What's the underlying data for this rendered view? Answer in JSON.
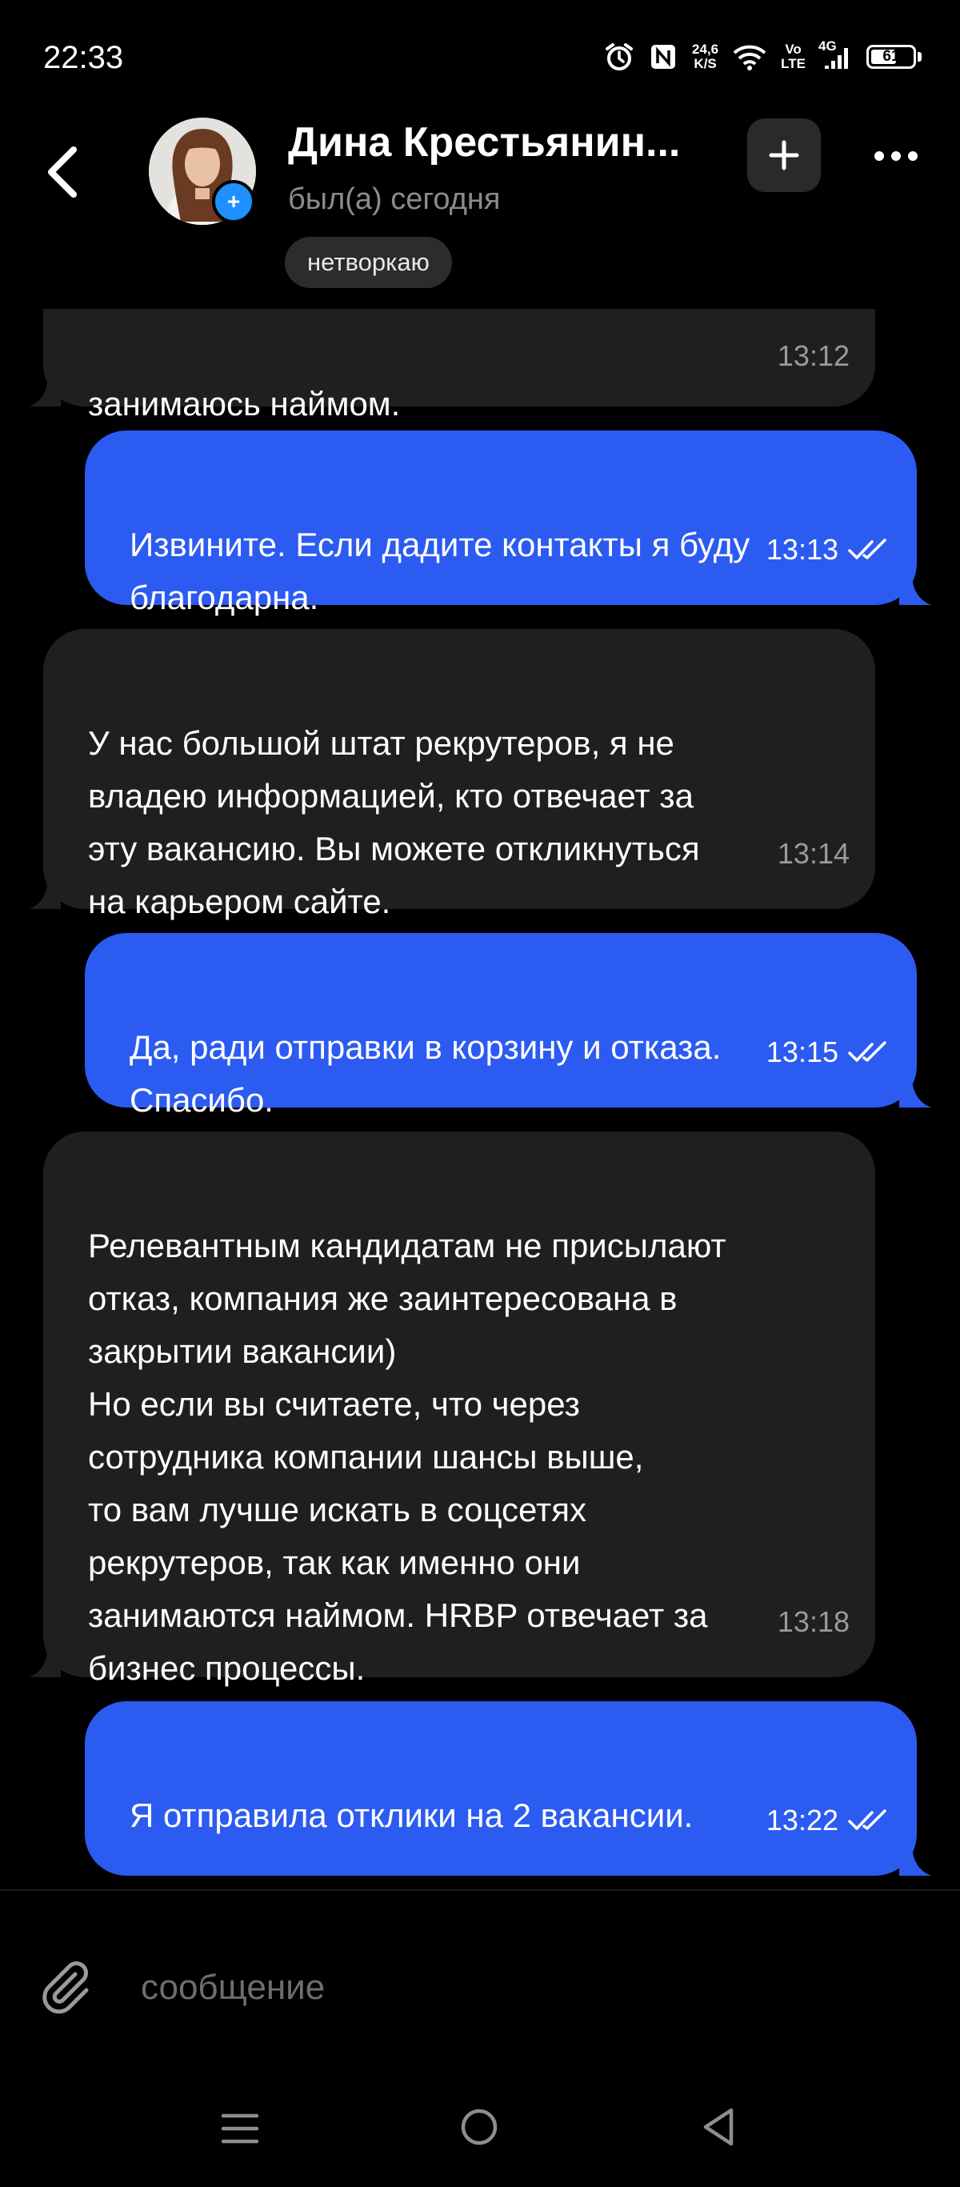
{
  "status_bar": {
    "time": "22:33",
    "net_speed_value": "24,6",
    "net_speed_unit": "K/S",
    "volte_top": "Vo",
    "volte_bottom": "LTE",
    "network": "4G",
    "battery": "61",
    "battery_level": 0.61
  },
  "header": {
    "contact_name": "Дина Крестьянин...",
    "contact_status": "был(а) сегодня",
    "tag": "нетворкаю",
    "icons": [
      "back-icon",
      "avatar",
      "add-icon",
      "more-icon"
    ]
  },
  "messages": [
    {
      "direction": "in",
      "text": "занимаюсь наймом.",
      "time": "13:12"
    },
    {
      "direction": "out",
      "text": "Извините. Если дадите контакты я буду\nблагодарна.",
      "time": "13:13",
      "status": "read"
    },
    {
      "direction": "in",
      "text": "У нас большой штат рекрутеров, я не\nвладею информацией, кто отвечает за\nэту вакансию. Вы можете откликнуться\nна карьером сайте.",
      "time": "13:14"
    },
    {
      "direction": "out",
      "text": "Да, ради отправки в корзину и отказа.\nСпасибо.",
      "time": "13:15",
      "status": "read"
    },
    {
      "direction": "in",
      "text": "Релевантным кандидатам не присылают\nотказ, компания же заинтересована в\nзакрытии вакансии)\nНо если вы считаете, что через\nсотрудника компании шансы выше,\nто вам лучше искать в соцсетях\nрекрутеров, так как именно они\nзанимаются наймом. HRBP отвечает за\nбизнес процессы.",
      "time": "13:18"
    },
    {
      "direction": "out",
      "text": "Я отправила отклики на 2 вакансии.",
      "time": "13:22",
      "status": "read"
    }
  ],
  "composer": {
    "placeholder": "сообщение"
  },
  "colors": {
    "background": "#000000",
    "incoming_bubble": "#1f1f21",
    "outgoing_bubble": "#2c5bf2",
    "secondary_text": "#8c8c8c",
    "avatar_badge": "#1e90ff"
  }
}
